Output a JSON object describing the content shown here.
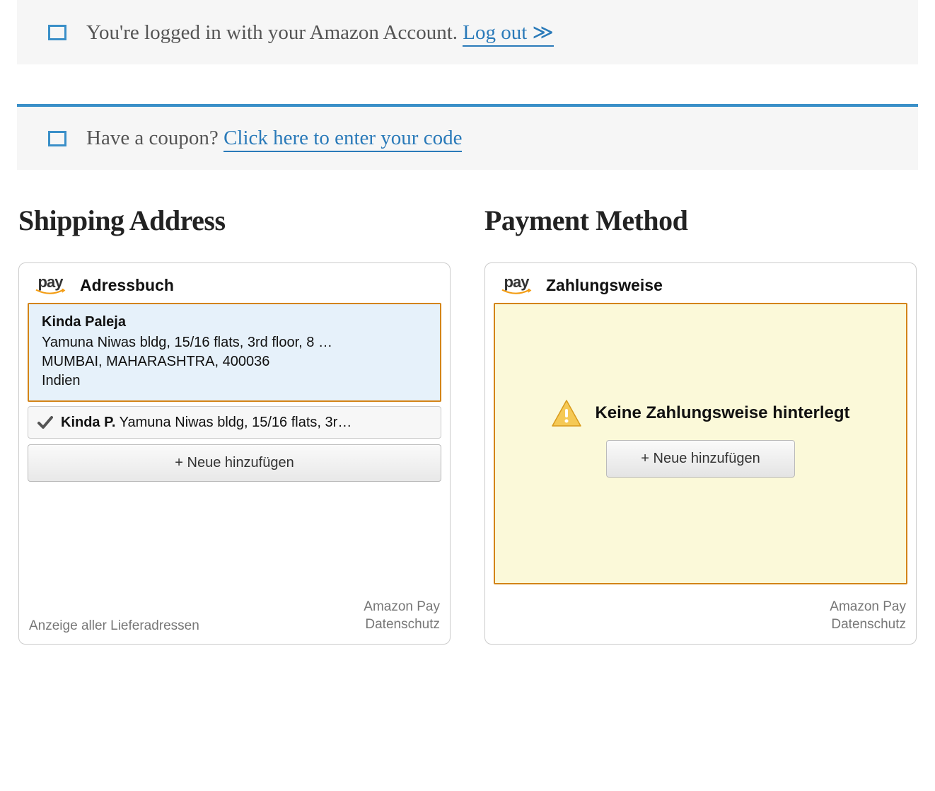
{
  "login_bar": {
    "text": "You're logged in with your Amazon Account. ",
    "link": "Log out ≫"
  },
  "coupon_bar": {
    "text": "Have a coupon? ",
    "link": "Click here to enter your code"
  },
  "shipping": {
    "heading": "Shipping Address",
    "widget_title": "Adressbuch",
    "selected": {
      "name": "Kinda Paleja",
      "line1": "Yamuna Niwas bldg, 15/16 flats, 3rd floor, 8 …",
      "line2": "MUMBAI, MAHARASHTRA, 400036",
      "line3": "Indien"
    },
    "option": {
      "name": "Kinda P.",
      "rest": " Yamuna Niwas bldg, 15/16 flats, 3r…"
    },
    "add_button": "+ Neue hinzufügen",
    "footer_left": "Anzeige aller Lieferadressen",
    "footer_right1": "Amazon Pay",
    "footer_right2": "Datenschutz"
  },
  "payment": {
    "heading": "Payment Method",
    "widget_title": "Zahlungsweise",
    "warning": "Keine Zahlungsweise hinterlegt",
    "add_button": "+ Neue hinzufügen",
    "footer_right1": "Amazon Pay",
    "footer_right2": "Datenschutz"
  }
}
